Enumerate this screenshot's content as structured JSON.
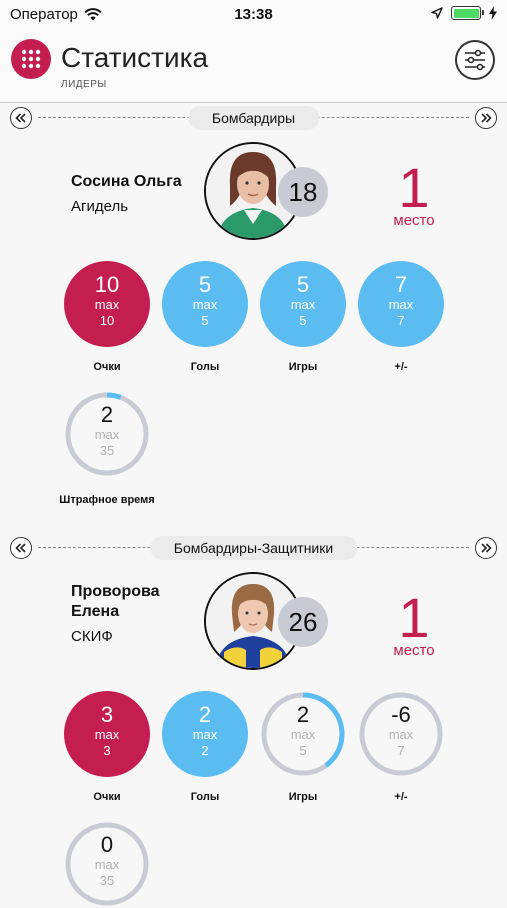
{
  "status_bar": {
    "carrier": "Оператор",
    "time": "13:38"
  },
  "header": {
    "title": "Статистика",
    "subtitle": "ЛИДЕРЫ"
  },
  "colors": {
    "accent": "#c41e50",
    "blue": "#5bbcf2",
    "ring": "#c9cbd4",
    "badge": "#c9cbd4"
  },
  "sections": [
    {
      "title": "Бомбардиры",
      "player": {
        "name_line1": "Сосина Ольга",
        "name_line2": "",
        "team": "Агидель",
        "number": "18",
        "place": "1",
        "place_word": "место"
      },
      "stats": [
        {
          "label": "Очки",
          "value": "10",
          "max_label": "max",
          "max": "10",
          "style": "red",
          "fraction": 1
        },
        {
          "label": "Голы",
          "value": "5",
          "max_label": "max",
          "max": "5",
          "style": "blue",
          "fraction": 1
        },
        {
          "label": "Игры",
          "value": "5",
          "max_label": "max",
          "max": "5",
          "style": "blue",
          "fraction": 1
        },
        {
          "label": "+/-",
          "value": "7",
          "max_label": "max",
          "max": "7",
          "style": "blue",
          "fraction": 1
        },
        {
          "label": "Штрафное время",
          "value": "2",
          "max_label": "max",
          "max": "35",
          "style": "ring",
          "fraction": 0.057
        }
      ]
    },
    {
      "title": "Бомбардиры-Защитники",
      "player": {
        "name_line1": "Проворова",
        "name_line2": "Елена",
        "team": "СКИФ",
        "number": "26",
        "place": "1",
        "place_word": "место"
      },
      "stats": [
        {
          "label": "Очки",
          "value": "3",
          "max_label": "max",
          "max": "3",
          "style": "red",
          "fraction": 1
        },
        {
          "label": "Голы",
          "value": "2",
          "max_label": "max",
          "max": "2",
          "style": "blue",
          "fraction": 1
        },
        {
          "label": "Игры",
          "value": "2",
          "max_label": "max",
          "max": "5",
          "style": "ring",
          "fraction": 0.4
        },
        {
          "label": "+/-",
          "value": "-6",
          "max_label": "max",
          "max": "7",
          "style": "ring",
          "fraction": 0
        },
        {
          "label": "",
          "value": "0",
          "max_label": "max",
          "max": "35",
          "style": "ring",
          "fraction": 0
        }
      ]
    }
  ]
}
